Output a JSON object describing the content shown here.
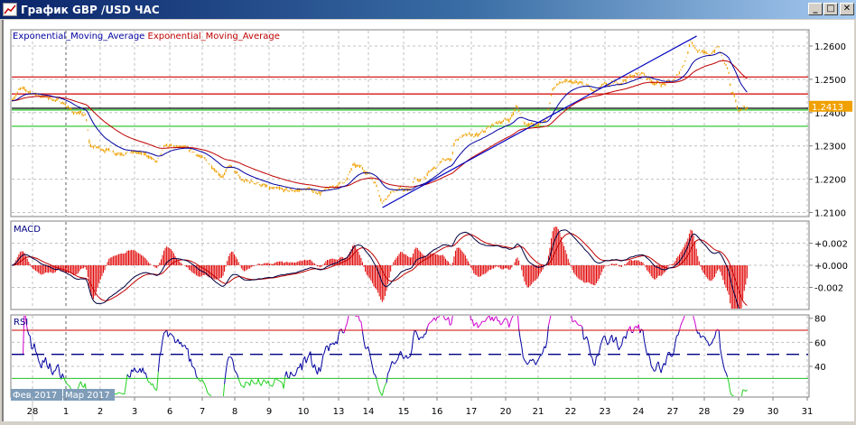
{
  "window": {
    "title": "График GBP /USD  ЧАС",
    "icon": "chart-icon",
    "buttons": [
      {
        "name": "minimize-button",
        "label": "_"
      },
      {
        "name": "maximize-button",
        "label": "□"
      },
      {
        "name": "close-button",
        "label": "✕"
      }
    ]
  },
  "colors": {
    "price_bars": "#f0a000",
    "ema_fast": "#0000a0",
    "ema_slow": "#c00000",
    "macd_line": "#000040",
    "macd_signal": "#c00000",
    "macd_hist": "#e00000",
    "rsi_line": "#0000a0",
    "rsi_overbought": "#d000d0",
    "rsi_oversold": "#20d020",
    "level_red": "#d00000",
    "level_green": "#20c020",
    "level_black": "#000000",
    "grid": "#c0c0c0",
    "title_bar": "#0a246a",
    "month_label_bg": "#7f9db9"
  },
  "chart_data": {
    "type": "line",
    "symbol": "GBP /USD",
    "timeframe": "ЧАС",
    "legend": [
      {
        "name": "Exponential_Moving_Average",
        "color": "#0000a0"
      },
      {
        "name": "Exponential_Moving_Average",
        "color": "#c00000"
      }
    ],
    "price_axis": {
      "ticks": [
        "1.2600",
        "1.2500",
        "1.2400",
        "1.2300",
        "1.2200",
        "1.2100"
      ],
      "range": [
        1.2085,
        1.265
      ]
    },
    "current_price": "1.2413",
    "horizontal_levels": [
      {
        "price": 1.2507,
        "color": "red"
      },
      {
        "price": 1.2456,
        "color": "red"
      },
      {
        "price": 1.2413,
        "color": "black"
      },
      {
        "price": 1.2408,
        "color": "green"
      },
      {
        "price": 1.2359,
        "color": "green"
      }
    ],
    "trendline": {
      "from": {
        "date": "03-14",
        "hour": 10,
        "price": 1.2115
      },
      "to": {
        "date": "03-27",
        "hour": 17,
        "price": 1.263
      }
    },
    "price_series": [
      {
        "date": "02-27",
        "hour": 9,
        "price": 1.244
      },
      {
        "date": "02-27",
        "hour": 15,
        "price": 1.247
      },
      {
        "date": "02-27",
        "hour": 20,
        "price": 1.2465
      },
      {
        "date": "02-28",
        "hour": 6,
        "price": 1.245
      },
      {
        "date": "02-28",
        "hour": 15,
        "price": 1.244
      },
      {
        "date": "02-28",
        "hour": 22,
        "price": 1.243
      },
      {
        "date": "03-01",
        "hour": 4,
        "price": 1.2405
      },
      {
        "date": "03-01",
        "hour": 14,
        "price": 1.239
      },
      {
        "date": "03-01",
        "hour": 17,
        "price": 1.23
      },
      {
        "date": "03-02",
        "hour": 3,
        "price": 1.229
      },
      {
        "date": "03-02",
        "hour": 12,
        "price": 1.228
      },
      {
        "date": "03-03",
        "hour": 1,
        "price": 1.228
      },
      {
        "date": "03-03",
        "hour": 10,
        "price": 1.227
      },
      {
        "date": "03-03",
        "hour": 16,
        "price": 1.225
      },
      {
        "date": "03-03",
        "hour": 22,
        "price": 1.23
      },
      {
        "date": "03-06",
        "hour": 8,
        "price": 1.2295
      },
      {
        "date": "03-06",
        "hour": 18,
        "price": 1.228
      },
      {
        "date": "03-07",
        "hour": 7,
        "price": 1.224
      },
      {
        "date": "03-07",
        "hour": 14,
        "price": 1.221
      },
      {
        "date": "03-07",
        "hour": 20,
        "price": 1.224
      },
      {
        "date": "03-08",
        "hour": 5,
        "price": 1.2195
      },
      {
        "date": "03-08",
        "hour": 16,
        "price": 1.219
      },
      {
        "date": "03-09",
        "hour": 1,
        "price": 1.217
      },
      {
        "date": "03-09",
        "hour": 14,
        "price": 1.2165
      },
      {
        "date": "03-10",
        "hour": 3,
        "price": 1.217
      },
      {
        "date": "03-10",
        "hour": 12,
        "price": 1.216
      },
      {
        "date": "03-10",
        "hour": 21,
        "price": 1.2175
      },
      {
        "date": "03-13",
        "hour": 6,
        "price": 1.22
      },
      {
        "date": "03-13",
        "hour": 10,
        "price": 1.224
      },
      {
        "date": "03-13",
        "hour": 16,
        "price": 1.2235
      },
      {
        "date": "03-14",
        "hour": 1,
        "price": 1.2215
      },
      {
        "date": "03-14",
        "hour": 6,
        "price": 1.218
      },
      {
        "date": "03-14",
        "hour": 10,
        "price": 1.213
      },
      {
        "date": "03-14",
        "hour": 15,
        "price": 1.216
      },
      {
        "date": "03-14",
        "hour": 23,
        "price": 1.217
      },
      {
        "date": "03-15",
        "hour": 5,
        "price": 1.2165
      },
      {
        "date": "03-15",
        "hour": 8,
        "price": 1.221
      },
      {
        "date": "03-15",
        "hour": 11,
        "price": 1.219
      },
      {
        "date": "03-15",
        "hour": 21,
        "price": 1.223
      },
      {
        "date": "03-16",
        "hour": 4,
        "price": 1.2255
      },
      {
        "date": "03-16",
        "hour": 10,
        "price": 1.226
      },
      {
        "date": "03-16",
        "hour": 13,
        "price": 1.232
      },
      {
        "date": "03-16",
        "hour": 20,
        "price": 1.233
      },
      {
        "date": "03-17",
        "hour": 5,
        "price": 1.233
      },
      {
        "date": "03-17",
        "hour": 11,
        "price": 1.235
      },
      {
        "date": "03-17",
        "hour": 18,
        "price": 1.237
      },
      {
        "date": "03-20",
        "hour": 3,
        "price": 1.238
      },
      {
        "date": "03-20",
        "hour": 8,
        "price": 1.242
      },
      {
        "date": "03-20",
        "hour": 13,
        "price": 1.237
      },
      {
        "date": "03-20",
        "hour": 23,
        "price": 1.236
      },
      {
        "date": "03-21",
        "hour": 6,
        "price": 1.238
      },
      {
        "date": "03-21",
        "hour": 10,
        "price": 1.247
      },
      {
        "date": "03-21",
        "hour": 16,
        "price": 1.249
      },
      {
        "date": "03-22",
        "hour": 2,
        "price": 1.249
      },
      {
        "date": "03-22",
        "hour": 12,
        "price": 1.248
      },
      {
        "date": "03-22",
        "hour": 17,
        "price": 1.246
      },
      {
        "date": "03-22",
        "hour": 23,
        "price": 1.248
      },
      {
        "date": "03-23",
        "hour": 10,
        "price": 1.249
      },
      {
        "date": "03-23",
        "hour": 19,
        "price": 1.251
      },
      {
        "date": "03-24",
        "hour": 3,
        "price": 1.252
      },
      {
        "date": "03-24",
        "hour": 9,
        "price": 1.2495
      },
      {
        "date": "03-24",
        "hour": 17,
        "price": 1.2485
      },
      {
        "date": "03-27",
        "hour": 1,
        "price": 1.2495
      },
      {
        "date": "03-27",
        "hour": 6,
        "price": 1.253
      },
      {
        "date": "03-27",
        "hour": 10,
        "price": 1.257
      },
      {
        "date": "03-27",
        "hour": 13,
        "price": 1.262
      },
      {
        "date": "03-27",
        "hour": 17,
        "price": 1.259
      },
      {
        "date": "03-28",
        "hour": 3,
        "price": 1.257
      },
      {
        "date": "03-28",
        "hour": 10,
        "price": 1.26
      },
      {
        "date": "03-28",
        "hour": 13,
        "price": 1.256
      },
      {
        "date": "03-28",
        "hour": 17,
        "price": 1.253
      },
      {
        "date": "03-28",
        "hour": 19,
        "price": 1.246
      },
      {
        "date": "03-28",
        "hour": 22,
        "price": 1.244
      },
      {
        "date": "03-29",
        "hour": 0,
        "price": 1.24
      },
      {
        "date": "03-29",
        "hour": 3,
        "price": 1.242
      },
      {
        "date": "03-29",
        "hour": 6,
        "price": 1.2413
      }
    ],
    "macd": {
      "label": "MACD",
      "ticks": [
        "+0.002",
        "+0.000",
        "-0.002"
      ]
    },
    "rsi": {
      "label": "RSI",
      "ticks": [
        "80",
        "60",
        "40"
      ],
      "levels": [
        70,
        50,
        30
      ]
    },
    "date_ticks": [
      "28",
      "1",
      "2",
      "3",
      "6",
      "7",
      "8",
      "9",
      "10",
      "13",
      "14",
      "15",
      "16",
      "17",
      "20",
      "21",
      "22",
      "23",
      "24",
      "27",
      "28",
      "29",
      "30",
      "31"
    ],
    "month_labels": [
      "Фев 2017",
      "Мар 2017"
    ]
  }
}
